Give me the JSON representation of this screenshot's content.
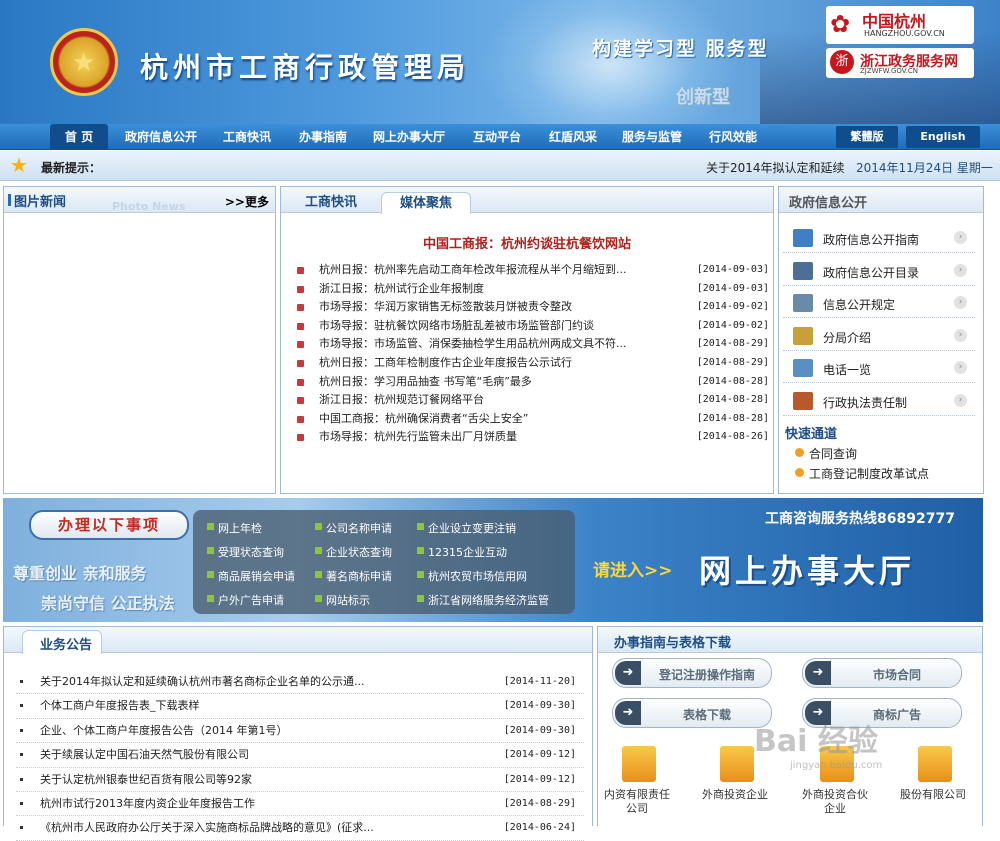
{
  "header": {
    "site_title": "杭州市工商行政管理局",
    "slogan": "构建学习型  服务型",
    "slogan2": "创新型",
    "logo_hangzhou": {
      "name": "中国杭州",
      "url": "HANGZHOU.GOV.CN"
    },
    "logo_zhejiang": {
      "name": "浙江政务服务网",
      "url": "ZJZWFW.GOV.CN"
    }
  },
  "nav": {
    "items": [
      "首 页",
      "政府信息公开",
      "工商快讯",
      "办事指南",
      "网上办事大厅",
      "互动平台",
      "红盾风采",
      "服务与监管",
      "行风效能"
    ],
    "traditional": "繁體版",
    "english": "English"
  },
  "ticker": {
    "label": "最新提示：",
    "message": "关于2014年拟认定和延续",
    "date": "2014年11月24日 星期一"
  },
  "photo_news": {
    "title": "图片新闻",
    "ghost": "Photo News",
    "more": ">>更多"
  },
  "news": {
    "tabs": [
      "工商快讯",
      "媒体聚焦"
    ],
    "headline": "中国工商报：杭州约谈驻杭餐饮网站",
    "items": [
      {
        "title": "杭州日报：杭州率先启动工商年检改年报流程从半个月缩短到...",
        "date": "[2014-09-03]"
      },
      {
        "title": "浙江日报：杭州试行企业年报制度",
        "date": "[2014-09-03]"
      },
      {
        "title": "市场导报：华润万家销售无标签散装月饼被责令整改",
        "date": "[2014-09-02]"
      },
      {
        "title": "市场导报：驻杭餐饮网络市场脏乱差被市场监管部门约谈",
        "date": "[2014-09-02]"
      },
      {
        "title": "市场导报：市场监管、消保委抽检学生用品杭州两成文具不符...",
        "date": "[2014-08-29]"
      },
      {
        "title": "杭州日报：工商年检制度作古企业年度报告公示试行",
        "date": "[2014-08-29]"
      },
      {
        "title": "杭州日报：学习用品抽查 书写笔“毛病”最多",
        "date": "[2014-08-28]"
      },
      {
        "title": "浙江日报：杭州规范订餐网络平台",
        "date": "[2014-08-28]"
      },
      {
        "title": "中国工商报：杭州确保消费者“舌尖上安全”",
        "date": "[2014-08-28]"
      },
      {
        "title": "市场导报：杭州先行监管未出厂月饼质量",
        "date": "[2014-08-26]"
      }
    ]
  },
  "gov_info": {
    "title": "政府信息公开",
    "items": [
      {
        "label": "政府信息公开指南",
        "icon": "org-chart-icon",
        "color": "#3f7fc2"
      },
      {
        "label": "政府信息公开目录",
        "icon": "checklist-icon",
        "color": "#4d6f95"
      },
      {
        "label": "信息公开规定",
        "icon": "document-icon",
        "color": "#6a8aa8"
      },
      {
        "label": "分局介绍",
        "icon": "building-icon",
        "color": "#c7a03a"
      },
      {
        "label": "电话一览",
        "icon": "phone-book-icon",
        "color": "#5b8fc4"
      },
      {
        "label": "行政执法责任制",
        "icon": "gavel-icon",
        "color": "#b7592a"
      }
    ],
    "quick_title": "快速通道",
    "quick_links": [
      "合同查询",
      "工商登记制度改革试点"
    ]
  },
  "service_band": {
    "tag": "办理以下事项",
    "slogan1": "尊重创业 亲和服务",
    "slogan2": "崇尚守信 公正执法",
    "services": [
      [
        "网上年检",
        "公司名称申请",
        "企业设立变更注销"
      ],
      [
        "受理状态查询",
        "企业状态查询",
        "12315企业互动"
      ],
      [
        "商品展销会申请",
        "著名商标申请",
        "杭州农贸市场信用网"
      ],
      [
        "户外广告申请",
        "网站标示",
        "浙江省网络服务经济监管"
      ]
    ],
    "hotline": "工商咨询服务热线86892777",
    "enter": "请进入>>",
    "hall": "网上办事大厅"
  },
  "announcements": {
    "title": "业务公告",
    "items": [
      {
        "title": "关于2014年拟认定和延续确认杭州市著名商标企业名单的公示通...",
        "date": "[2014-11-20]"
      },
      {
        "title": "个体工商户年度报告表_下载表样",
        "date": "[2014-09-30]"
      },
      {
        "title": "企业、个体工商户年度报告公告（2014 年第1号）",
        "date": "[2014-09-30]"
      },
      {
        "title": "关于续展认定中国石油天然气股份有限公司",
        "date": "[2014-09-12]"
      },
      {
        "title": "关于认定杭州银泰世纪百货有限公司等92家",
        "date": "[2014-09-12]"
      },
      {
        "title": "杭州市试行2013年度内资企业年度报告工作",
        "date": "[2014-08-29]"
      },
      {
        "title": "《杭州市人民政府办公厅关于深入实施商标品牌战略的意见》(征求...",
        "date": "[2014-06-24]"
      }
    ]
  },
  "guide": {
    "title": "办事指南与表格下载",
    "buttons": [
      "登记注册操作指南",
      "市场合同",
      "表格下载",
      "商标广告"
    ],
    "entities": [
      "内资有限责任公司",
      "外商投资企业",
      "外商投资合伙企业",
      "股份有限公司"
    ]
  },
  "watermark": {
    "text": "Bai 经验",
    "url": "jingyan.baidu.com"
  }
}
